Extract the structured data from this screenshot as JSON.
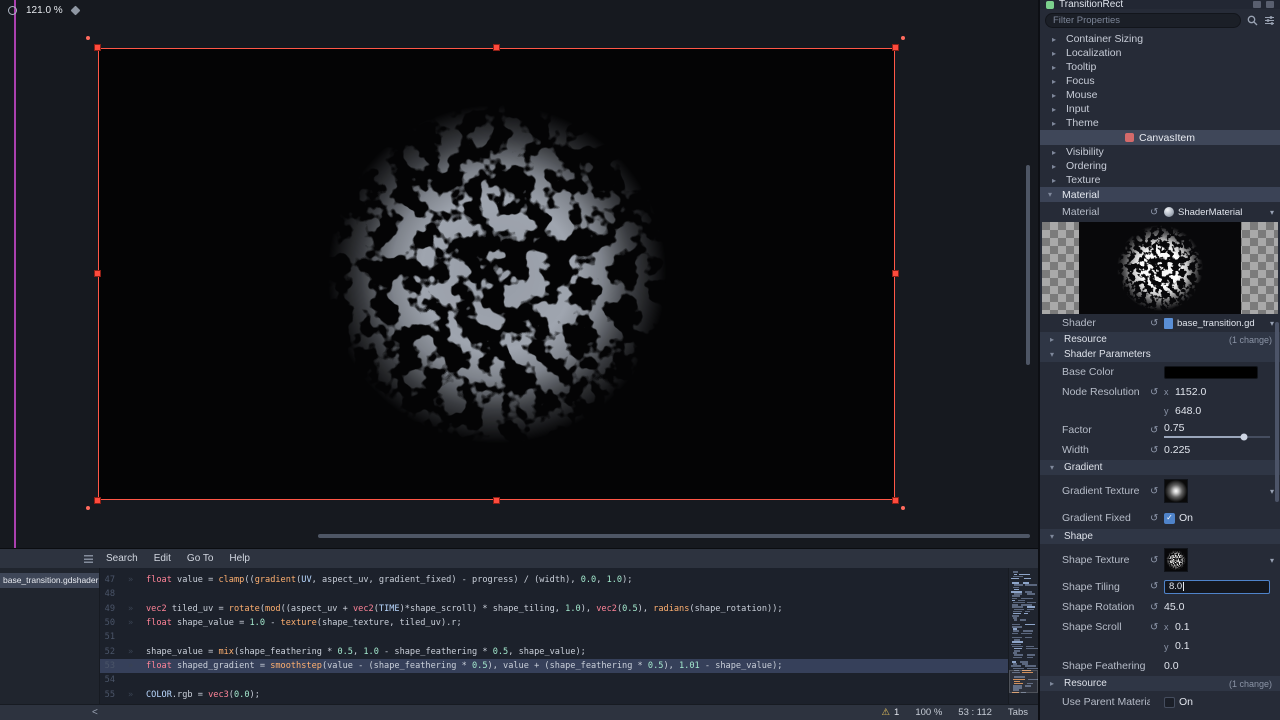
{
  "viewport": {
    "zoom_label": "121.0 %"
  },
  "shader_editor": {
    "menus": [
      "Search",
      "Edit",
      "Go To",
      "Help"
    ],
    "file_tab": "base_transition.gdshader",
    "status": {
      "warning_count": "1",
      "zoom": "100 %",
      "caret": "53 : 112",
      "indent_mode": "Tabs"
    },
    "lines": [
      {
        "no": "47",
        "hl": false,
        "segs": [
          [
            "k",
            "float"
          ],
          [
            "p",
            " value = "
          ],
          [
            "f",
            "clamp"
          ],
          [
            "p",
            "(("
          ],
          [
            "f",
            "gradient"
          ],
          [
            "p",
            "("
          ],
          [
            "b",
            "UV"
          ],
          [
            "p",
            ", aspect_uv, gradient_fixed) - progress) / (width), "
          ],
          [
            "n",
            "0.0"
          ],
          [
            "p",
            ", "
          ],
          [
            "n",
            "1.0"
          ],
          [
            "p",
            ");"
          ]
        ]
      },
      {
        "no": "48",
        "hl": false,
        "segs": []
      },
      {
        "no": "49",
        "hl": false,
        "segs": [
          [
            "k",
            "vec2"
          ],
          [
            "p",
            " tiled_uv = "
          ],
          [
            "f",
            "rotate"
          ],
          [
            "p",
            "("
          ],
          [
            "f",
            "mod"
          ],
          [
            "p",
            "((aspect_uv + "
          ],
          [
            "k",
            "vec2"
          ],
          [
            "p",
            "("
          ],
          [
            "b",
            "TIME"
          ],
          [
            "p",
            ")*shape_scroll) * shape_tiling, "
          ],
          [
            "n",
            "1.0"
          ],
          [
            "p",
            "), "
          ],
          [
            "k",
            "vec2"
          ],
          [
            "p",
            "("
          ],
          [
            "n",
            "0.5"
          ],
          [
            "p",
            "), "
          ],
          [
            "f",
            "radians"
          ],
          [
            "p",
            "(shape_rotation));"
          ]
        ]
      },
      {
        "no": "50",
        "hl": false,
        "segs": [
          [
            "k",
            "float"
          ],
          [
            "p",
            " shape_value = "
          ],
          [
            "n",
            "1.0"
          ],
          [
            "p",
            " - "
          ],
          [
            "f",
            "texture"
          ],
          [
            "p",
            "(shape_texture, tiled_uv).r;"
          ]
        ]
      },
      {
        "no": "51",
        "hl": false,
        "segs": []
      },
      {
        "no": "52",
        "hl": false,
        "segs": [
          [
            "p",
            "shape_value = "
          ],
          [
            "f",
            "mix"
          ],
          [
            "p",
            "(shape_feathering * "
          ],
          [
            "n",
            "0.5"
          ],
          [
            "p",
            ", "
          ],
          [
            "n",
            "1.0"
          ],
          [
            "p",
            " - shape_feathering * "
          ],
          [
            "n",
            "0.5"
          ],
          [
            "p",
            ", shape_value);"
          ]
        ]
      },
      {
        "no": "53",
        "hl": true,
        "segs": [
          [
            "k",
            "float"
          ],
          [
            "p",
            " shaped_gradient = "
          ],
          [
            "f",
            "smoothstep"
          ],
          [
            "p",
            "(value - (shape_feathering * "
          ],
          [
            "n",
            "0.5"
          ],
          [
            "p",
            "), value + (shape_feathering * "
          ],
          [
            "n",
            "0.5"
          ],
          [
            "p",
            "), "
          ],
          [
            "n",
            "1.01"
          ],
          [
            "p",
            " - shape_value);"
          ]
        ]
      },
      {
        "no": "54",
        "hl": false,
        "segs": []
      },
      {
        "no": "55",
        "hl": false,
        "segs": [
          [
            "b",
            "COLOR"
          ],
          [
            "p",
            ".rgb = "
          ],
          [
            "k",
            "vec3"
          ],
          [
            "p",
            "("
          ],
          [
            "n",
            "0.0"
          ],
          [
            "p",
            ");"
          ]
        ]
      }
    ]
  },
  "inspector": {
    "node_name": "TransitionRect",
    "filter_placeholder": "Filter Properties",
    "collapsed_top": [
      "Container Sizing",
      "Localization",
      "Tooltip",
      "Focus",
      "Mouse",
      "Input",
      "Theme"
    ],
    "category": "CanvasItem",
    "collapsed_mid": [
      "Visibility",
      "Ordering",
      "Texture"
    ],
    "material_header": "Material",
    "material_label": "Material",
    "material_value": "ShaderMaterial",
    "shader_label": "Shader",
    "shader_value": "base_transition.gd",
    "resource_label": "Resource",
    "resource_badge": "(1 change)",
    "params_header": "Shader Parameters",
    "base_color_label": "Base Color",
    "node_res_label": "Node Resolution",
    "node_res_x": "1152.0",
    "node_res_y": "648.0",
    "factor_label": "Factor",
    "factor_value": "0.75",
    "width_label": "Width",
    "width_value": "0.225",
    "gradient_header": "Gradient",
    "gradient_texture_label": "Gradient Texture",
    "gradient_fixed_label": "Gradient Fixed",
    "gradient_fixed_value": "On",
    "shape_header": "Shape",
    "shape_texture_label": "Shape Texture",
    "shape_tiling_label": "Shape Tiling",
    "shape_tiling_value": "8.0",
    "shape_rotation_label": "Shape Rotation",
    "shape_rotation_value": "45.0",
    "shape_scroll_label": "Shape Scroll",
    "shape_scroll_x": "0.1",
    "shape_scroll_y": "0.1",
    "shape_feathering_label": "Shape Feathering",
    "shape_feathering_value": "0.0",
    "resource2_label": "Resource",
    "resource2_badge": "(1 change)",
    "use_parent_label": "Use Parent Material",
    "use_parent_value": "On",
    "axis_x": "x",
    "axis_y": "y"
  },
  "icons": {
    "fold_closed": "▸",
    "fold_open": "▾",
    "chevron_down": "▾",
    "revert": "↺",
    "check": "✓",
    "warning": "⚠",
    "tab_marker": "»",
    "collapse_left": "<"
  },
  "colors": {
    "selection": "#ff5747",
    "guide": "#c648c9",
    "accent_blue": "#4f83c9",
    "line_highlight": "#36405a"
  }
}
